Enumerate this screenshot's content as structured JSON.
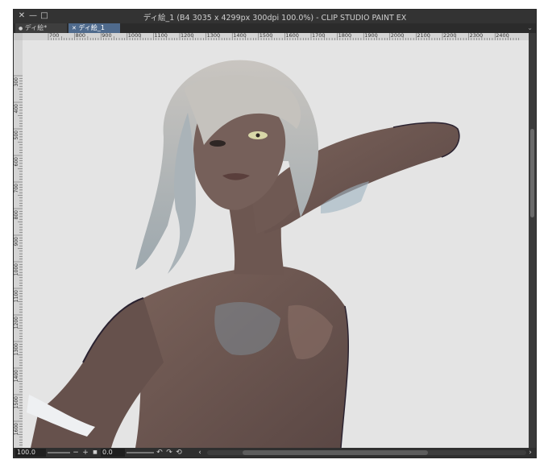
{
  "window": {
    "title": "ディ絵_1 (B4 3035 x 4299px 300dpi 100.0%)  - CLIP STUDIO PAINT EX",
    "close_glyph": "✕",
    "minimize_glyph": "—",
    "maximize_glyph": "□"
  },
  "tabs": [
    {
      "label": "ディ絵*",
      "glyph": "●",
      "active": false
    },
    {
      "label": "ディ絵_1",
      "glyph": "✕",
      "active": true
    }
  ],
  "tab_overflow_glyph": "⌄",
  "ruler_h_labels": [
    "700",
    "800",
    "900",
    "1000",
    "1100",
    "1200",
    "1300",
    "1400",
    "1500",
    "1600",
    "1700",
    "1800",
    "1900",
    "2000",
    "2100",
    "2200",
    "2300",
    "2400"
  ],
  "ruler_v_labels": [
    "300",
    "400",
    "500",
    "600",
    "700",
    "800",
    "900",
    "1000",
    "1100",
    "1200",
    "1300",
    "1400",
    "1500",
    "1600"
  ],
  "status": {
    "zoom_value": "100.0",
    "rotation_value": "0.0",
    "minus_glyph": "−",
    "plus_glyph": "+",
    "fit_glyph": "■",
    "rotate_left_glyph": "↶",
    "rotate_right_glyph": "↷",
    "reset_glyph": "⟲",
    "scroll_left_glyph": "‹",
    "scroll_right_glyph": "›"
  },
  "colors": {
    "canvas_bg": "#e4e4e4",
    "window_bg": "#3b3b3b",
    "active_tab": "#4f6a8c",
    "skin": "#6e5750",
    "hair": "#b9b6b2",
    "highlight_blue": "#9fb4c2"
  }
}
